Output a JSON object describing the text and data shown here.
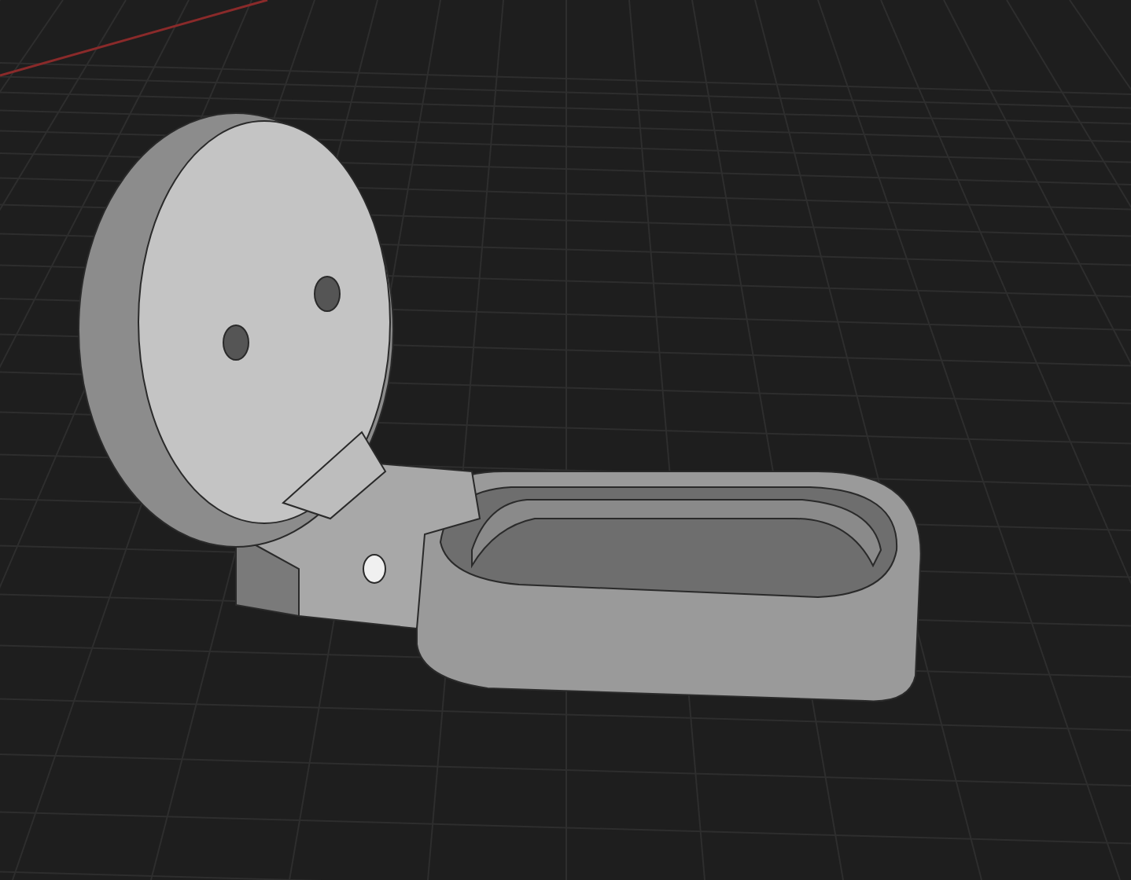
{
  "viewport": {
    "show_grid": true,
    "show_x_axis": true
  }
}
